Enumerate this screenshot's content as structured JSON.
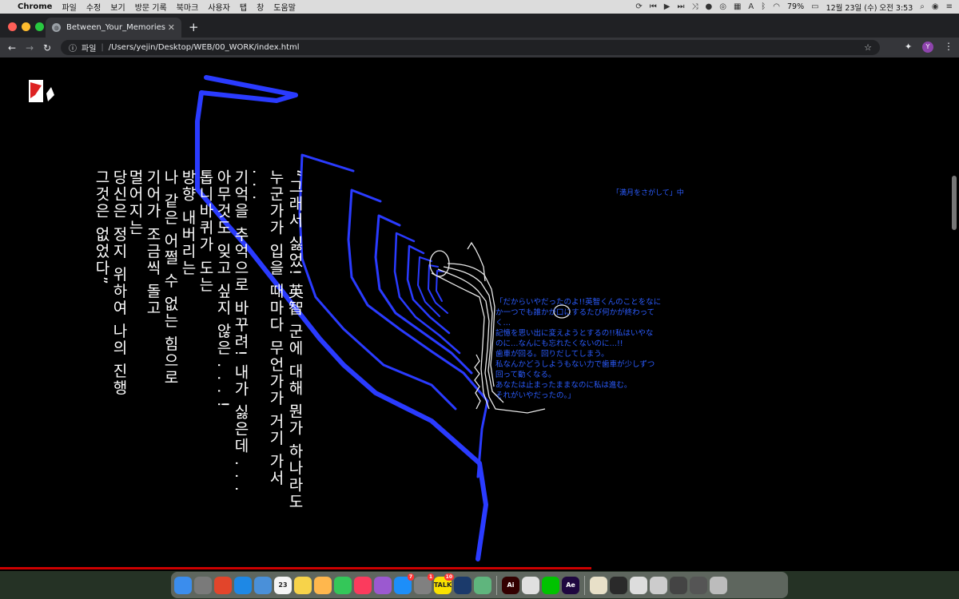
{
  "menubar": {
    "app": "Chrome",
    "items": [
      "파일",
      "수정",
      "보기",
      "방문 기록",
      "북마크",
      "사용자",
      "탭",
      "창",
      "도움말"
    ],
    "battery": "79%",
    "datetime": "12월 23일 (수) 오전  3:53"
  },
  "browser": {
    "tab_title": "Between_Your_Memories",
    "scheme_label": "파일",
    "url": "/Users/yejin/Desktop/WEB/00_WORK/index.html",
    "profile_initial": "Y"
  },
  "page": {
    "poem_lines": [
      "“그래서 싫었! 英智 군에 대해 뭔가 하나라도",
      "누군가가  입을  때마다  무언가가  거기  가서",
      ". . .",
      "기억을 추억으로 바꾸려! 내가 싫은데 . . .",
      "아무것도 잊고 싶지 않은 . . . !",
      "톱니바퀴가 도는",
      "방향 내버리는",
      "나 같은 어쩔 수 없는 힘으로",
      "기어가 조금씩 돌고",
      "멀어지는",
      "당신은 정지 위하여  나의 진행",
      "그것은 없었다”"
    ],
    "jp_caption": "「満月をさがして」中",
    "jp_lines": [
      "「だからいやだったのよ!!英智くんのことをなに",
      "か一つでも誰かが口にするたび何かが終わって",
      "く…",
      "記憶を思い出に変えようとするの!!私はいやな",
      "のに…なんにも忘れたくないのに…!!",
      "歯車が回る。回りだしてしまう。",
      "私なんかどうしようもない力で歯車が少しずつ",
      "回って動くなる。",
      "あなたは止まったままなのに私は進む。",
      "それがいやだったの。」"
    ],
    "colors": {
      "background": "#000000",
      "line_blue": "#2a3bff",
      "text_blue": "#2b5cff",
      "progress_red": "#cc0000"
    }
  },
  "dock": {
    "icons": [
      {
        "name": "finder",
        "label": "",
        "color": "#3b8ded"
      },
      {
        "name": "launchpad",
        "label": "",
        "color": "#7a7a7a"
      },
      {
        "name": "chrome",
        "label": "",
        "color": "#e2452b"
      },
      {
        "name": "safari",
        "label": "",
        "color": "#1e88e5"
      },
      {
        "name": "preview",
        "label": "",
        "color": "#4a90d9"
      },
      {
        "name": "calendar",
        "label": "23",
        "color": "#f5f5f5"
      },
      {
        "name": "notes",
        "label": "",
        "color": "#f7d34a"
      },
      {
        "name": "photos",
        "label": "",
        "color": "#ffb74d"
      },
      {
        "name": "messages",
        "label": "",
        "color": "#34c759"
      },
      {
        "name": "music",
        "label": "",
        "color": "#fb3b5d"
      },
      {
        "name": "podcasts",
        "label": "",
        "color": "#9b59d0"
      },
      {
        "name": "app-store",
        "label": "",
        "color": "#1c8ef9",
        "badge": "7"
      },
      {
        "name": "system-preferences",
        "label": "",
        "color": "#808080",
        "badge": "1"
      },
      {
        "name": "kakaotalk",
        "label": "TALK",
        "color": "#fae100",
        "badge": "10"
      },
      {
        "name": "cinema4d",
        "label": "",
        "color": "#1b3a6b"
      },
      {
        "name": "atom",
        "label": "",
        "color": "#5fb57d"
      },
      {
        "name": "illustrator",
        "label": "Ai",
        "color": "#330000"
      },
      {
        "name": "acrobat",
        "label": "",
        "color": "#e0e0e0"
      },
      {
        "name": "line",
        "label": "",
        "color": "#00c300"
      },
      {
        "name": "after-effects",
        "label": "Ae",
        "color": "#1f0740"
      },
      {
        "name": "document-1",
        "label": "",
        "color": "#e8e0c8"
      },
      {
        "name": "document-2",
        "label": "",
        "color": "#2a2a2a"
      },
      {
        "name": "document-3",
        "label": "",
        "color": "#dddddd"
      },
      {
        "name": "document-4",
        "label": "",
        "color": "#cccccc"
      },
      {
        "name": "document-5",
        "label": "",
        "color": "#444444"
      },
      {
        "name": "document-6",
        "label": "",
        "color": "#555555"
      },
      {
        "name": "trash",
        "label": "",
        "color": "#bcbcbc"
      }
    ]
  }
}
